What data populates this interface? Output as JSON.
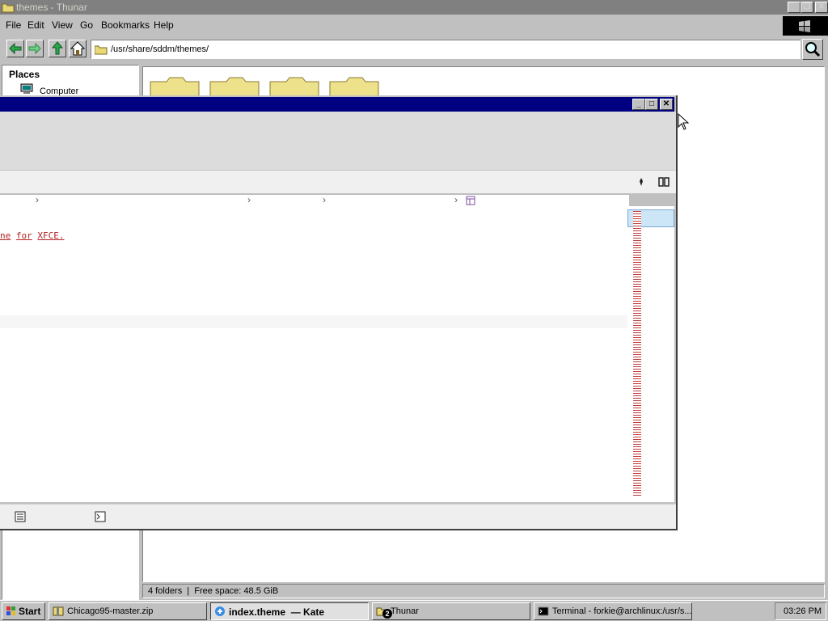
{
  "thunar": {
    "title": "themes - Thunar",
    "menu": [
      "File",
      "Edit",
      "View",
      "Go",
      "Bookmarks",
      "Help"
    ],
    "location": "/usr/share/sddm/themes/",
    "sidebar": {
      "heading": "Places",
      "items": [
        {
          "label": "Computer"
        }
      ]
    },
    "folders": 4,
    "status": "4 folders  |  Free space: 48.5 GiB"
  },
  "kate": {
    "code_fragment": [
      "ne",
      "for",
      "XFCE."
    ]
  },
  "taskbar": {
    "start_label": "Start",
    "tasks": [
      {
        "label": "Chicago95-master.zip",
        "icon": "archive-icon"
      },
      {
        "label": "index.theme  — Kate",
        "icon": "kate-icon",
        "active": true
      },
      {
        "label": "Thunar",
        "icon": "folder-icon",
        "badge": "2"
      },
      {
        "label": "Terminal - forkie@archlinux:/usr/s...",
        "icon": "terminal-icon"
      }
    ],
    "clock": "03:26 PM"
  },
  "colors": {
    "title_active": "#000080",
    "title_inactive": "#808080",
    "face": "#c0c0c0",
    "code_text": "#b22222",
    "folder": "#f0e68c"
  }
}
